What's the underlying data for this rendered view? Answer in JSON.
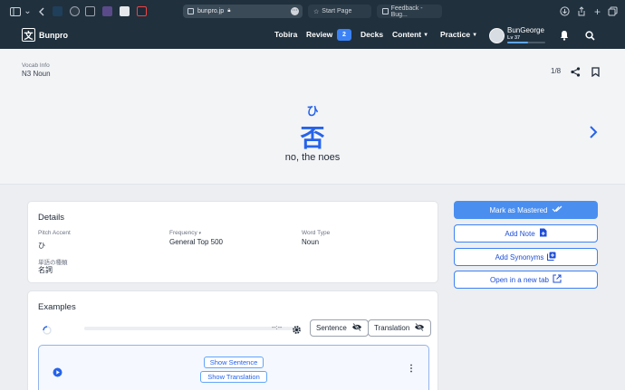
{
  "browser": {
    "url": "bunpro.jp",
    "tabs": [
      "Start Page",
      "Feedback - Bug..."
    ]
  },
  "header": {
    "brand": "Bunpro",
    "logo_glyph": "文",
    "nav": [
      "Tobira",
      "Review",
      "Decks",
      "Content",
      "Practice"
    ],
    "review_count": "2",
    "user_name": "BunGeorge",
    "user_level": "Lv 37",
    "level_progress": 0.55
  },
  "vocab": {
    "section_label": "Vocab Info",
    "level": "N3 Noun",
    "counter": "1/8",
    "reading": "ひ",
    "word": "否",
    "meaning": "no, the noes"
  },
  "details": {
    "title": "Details",
    "pitch_accent_label": "Pitch Accent",
    "pitch_accent_value": "ひ",
    "frequency_label": "Frequency",
    "frequency_value": "General Top 500",
    "word_type_label": "Word Type",
    "word_type_value": "Noun",
    "jp_word_type_label": "単語の種類",
    "jp_word_type_value": "名詞"
  },
  "actions": {
    "mark_mastered": "Mark as Mastered",
    "add_note": "Add Note",
    "add_synonyms": "Add Synonyms",
    "open_new_tab": "Open in a new tab"
  },
  "examples": {
    "title": "Examples",
    "time": "--:--",
    "sentence_toggle": "Sentence",
    "translation_toggle": "Translation",
    "show_sentence": "Show Sentence",
    "show_translation": "Show Translation"
  },
  "colors": {
    "accent": "#2563eb",
    "header_bg": "#20303d",
    "primary_button": "#4a8ef0"
  }
}
